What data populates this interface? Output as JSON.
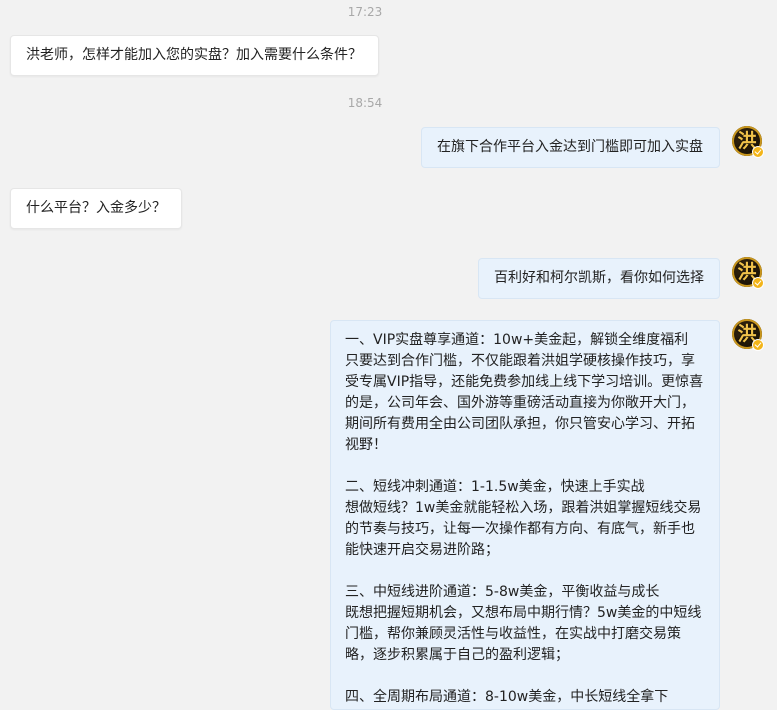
{
  "conversation": {
    "timestamps": [
      "17:23",
      "18:54"
    ],
    "messages": [
      {
        "side": "left",
        "text": "洪老师，怎样才能加入您的实盘？加入需要什么条件？"
      },
      {
        "side": "right",
        "text": "在旗下合作平台入金达到门槛即可加入实盘"
      },
      {
        "side": "left",
        "text": "什么平台？入金多少？"
      },
      {
        "side": "right",
        "text": "百利好和柯尔凯斯，看你如何选择"
      },
      {
        "side": "right",
        "text": "一、VIP实盘尊享通道：10w+美金起，解锁全维度福利\n只要达到合作门槛，不仅能跟着洪姐学硬核操作技巧，享受专属VIP指导，还能免费参加线上线下学习培训。更惊喜的是，公司年会、国外游等重磅活动直接为你敞开大门，期间所有费用全由公司团队承担，你只管安心学习、开拓视野！\n\n二、短线冲刺通道：1-1.5w美金，快速上手实战\n想做短线？1w美金就能轻松入场，跟着洪姐掌握短线交易的节奏与技巧，让每一次操作都有方向、有底气，新手也能快速开启交易进阶路；\n\n三、中短线进阶通道：5-8w美金，平衡收益与成长\n既想把握短期机会，又想布局中期行情？5w美金的中短线门槛，帮你兼顾灵活性与收益性，在实战中打磨交易策略，逐步积累属于自己的盈利逻辑；\n\n四、全周期布局通道：8-10w美金，中长短线全拿下"
      }
    ]
  },
  "avatar": {
    "glyph": "洪",
    "icon": "user-avatar-icon",
    "badge": "verified-badge-icon"
  },
  "colors": {
    "background": "#f2f2f2",
    "left_bubble": "#ffffff",
    "right_bubble": "#e8f2fc",
    "timestamp": "#a8a8a8",
    "avatar_ring": "#c8961e",
    "badge": "#f3b51a"
  }
}
